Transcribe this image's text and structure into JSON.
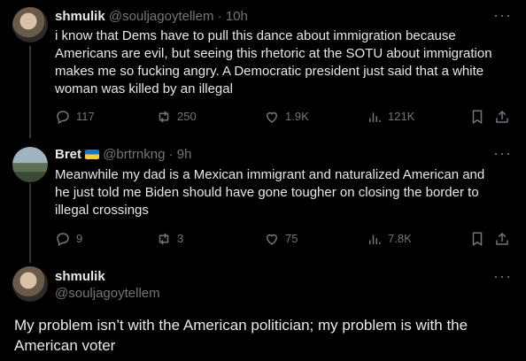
{
  "tweets": [
    {
      "display_name": "shmulik",
      "handle": "@souljagoytellem",
      "separator": "·",
      "time": "10h",
      "text": "i know that Dems have to pull this dance about immigration because\nAmericans are evil, but seeing this rhetoric at the SOTU about immigration\nmakes me so fucking angry. A Democratic president just said that a white\nwoman was killed by an illegal",
      "replies": "117",
      "reposts": "250",
      "likes": "1.9K",
      "views": "121K"
    },
    {
      "display_name": "Bret",
      "handle": "@brtrnkng",
      "separator": "·",
      "time": "9h",
      "text": "Meanwhile my dad is a Mexican immigrant and naturalized American and\nhe just told me Biden should have gone tougher on closing the border to\nillegal crossings",
      "replies": "9",
      "reposts": "3",
      "likes": "75",
      "views": "7.8K"
    }
  ],
  "main_tweet": {
    "display_name": "shmulik",
    "handle": "@souljagoytellem",
    "text": "My problem isn’t with the American politician; my problem is with the\nAmerican voter"
  },
  "more_label": "···"
}
